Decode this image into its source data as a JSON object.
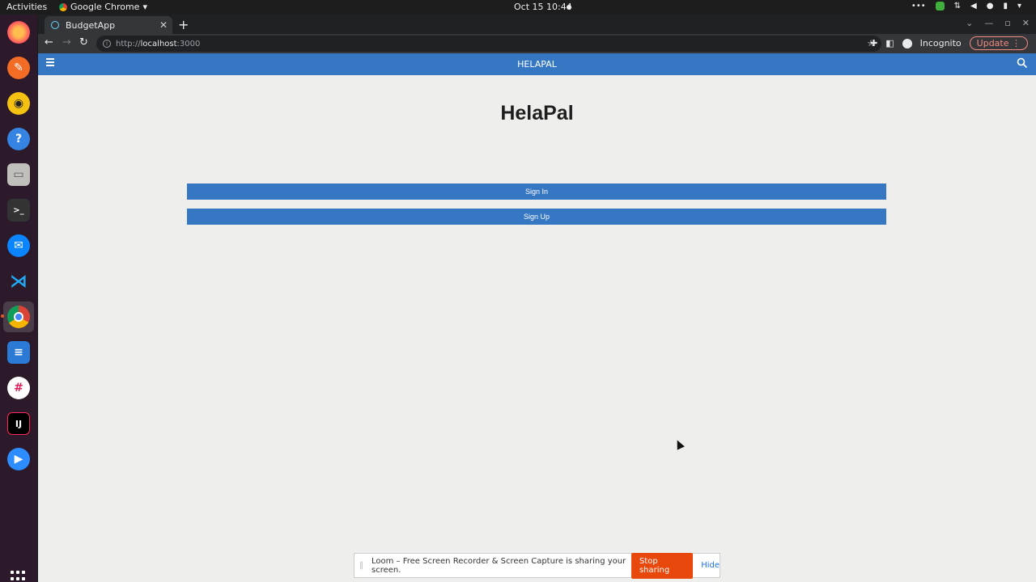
{
  "system_bar": {
    "activities": "Activities",
    "app_menu": "Google Chrome",
    "clock": "Oct 15  10:44"
  },
  "dock": {
    "items": [
      "firefox-icon",
      "inkscape-icon",
      "rhythmbox-icon",
      "help-icon",
      "files-icon",
      "terminal-icon",
      "thunderbird-icon",
      "vscode-icon",
      "chrome-icon",
      "writer-icon",
      "slack-icon",
      "intellij-icon",
      "zoom-icon"
    ]
  },
  "browser": {
    "tab_title": "BudgetApp",
    "url_scheme": "http://",
    "url_host": "localhost",
    "url_port": ":3000",
    "profile": "Incognito",
    "update_label": "Update"
  },
  "app": {
    "brand": "HELAPAL",
    "title": "HelaPal",
    "sign_in": "Sign In",
    "sign_up": "Sign Up",
    "accent_color": "#3577c2"
  },
  "loom": {
    "message": "Loom – Free Screen Recorder & Screen Capture is sharing your screen.",
    "stop": "Stop sharing",
    "hide": "Hide"
  }
}
